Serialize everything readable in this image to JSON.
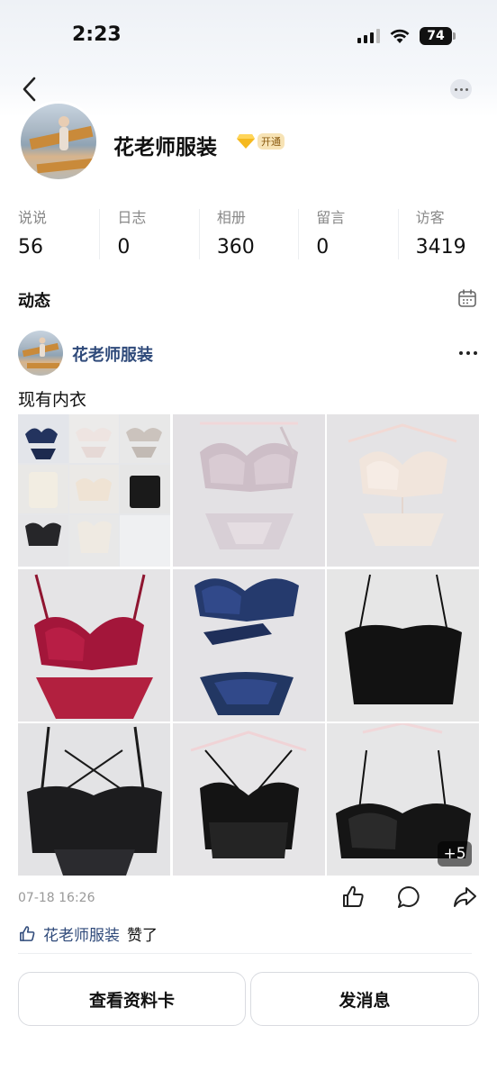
{
  "status_bar": {
    "time": "2:23",
    "battery": "74"
  },
  "profile": {
    "name": "花老师服装",
    "vip_label": "开通"
  },
  "stats": [
    {
      "label": "说说",
      "value": "56"
    },
    {
      "label": "日志",
      "value": "0"
    },
    {
      "label": "相册",
      "value": "360"
    },
    {
      "label": "留言",
      "value": "0"
    },
    {
      "label": "访客",
      "value": "3419"
    }
  ],
  "feed": {
    "title": "动态"
  },
  "post": {
    "author": "花老师服装",
    "text": "现有内衣",
    "time": "07-18 16:26",
    "more_photos": "+5",
    "liked_by": "花老师服装",
    "liked_suffix": "赞了"
  },
  "buttons": {
    "view_card": "查看资料卡",
    "send_message": "发消息"
  }
}
